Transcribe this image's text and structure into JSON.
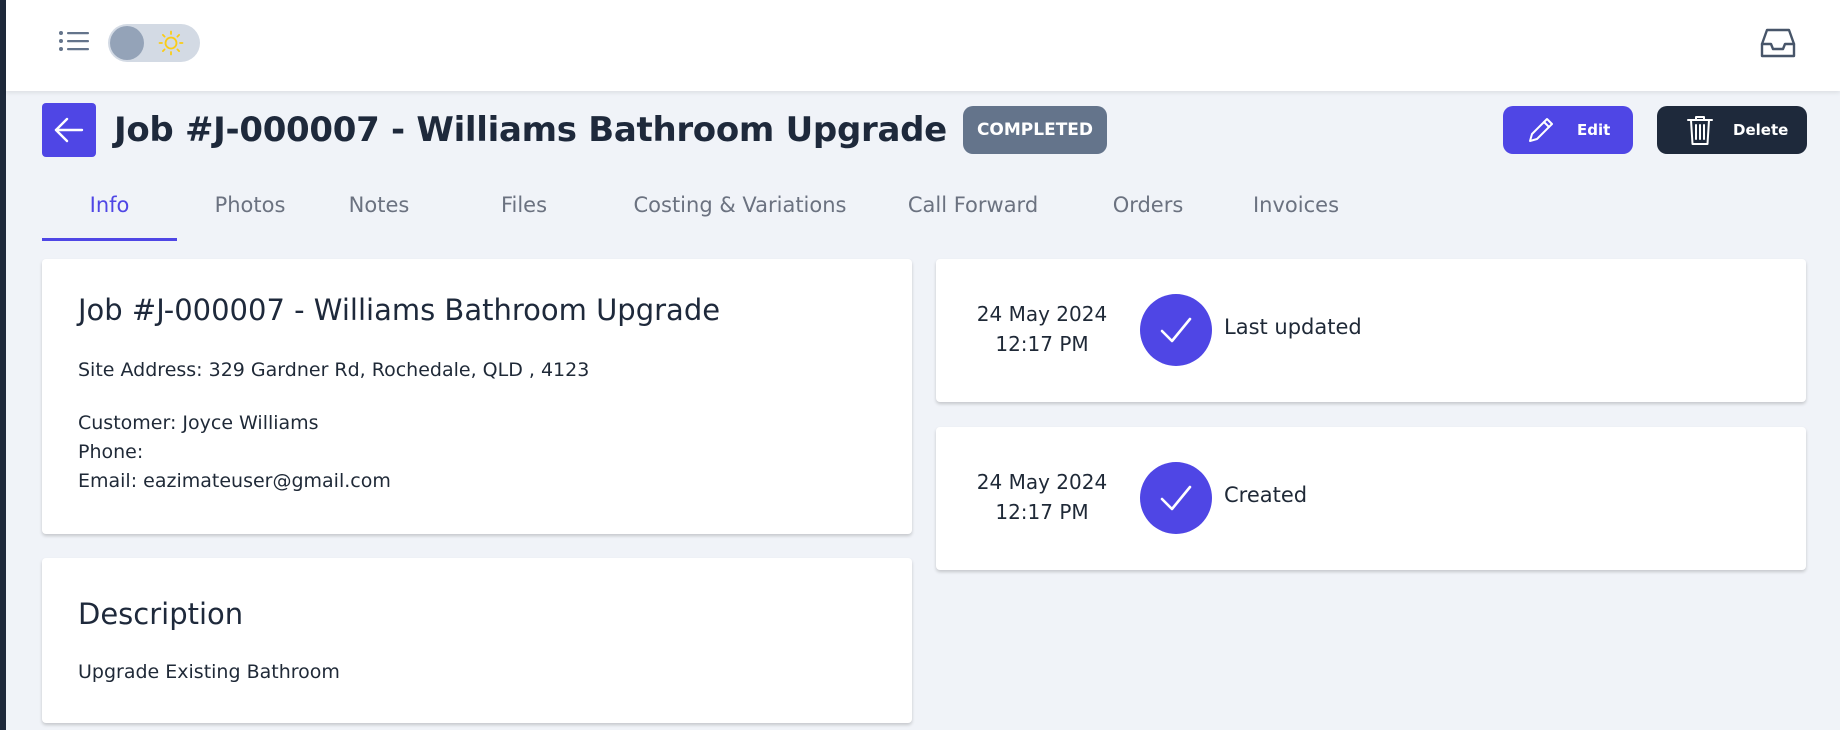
{
  "topbar": {
    "menu_icon": "list-icon",
    "theme_icon": "sun-icon",
    "inbox_icon": "inbox-icon"
  },
  "header": {
    "title": "Job #J-000007 - Williams Bathroom Upgrade",
    "status": "COMPLETED",
    "edit_label": "Edit",
    "delete_label": "Delete"
  },
  "tabs": [
    {
      "label": "Info",
      "active": true
    },
    {
      "label": "Photos"
    },
    {
      "label": "Notes"
    },
    {
      "label": "Files"
    },
    {
      "label": "Costing & Variations"
    },
    {
      "label": "Call Forward"
    },
    {
      "label": "Orders"
    },
    {
      "label": "Invoices"
    }
  ],
  "job": {
    "title": "Job #J-000007 - Williams Bathroom Upgrade",
    "site_address": "Site Address: 329 Gardner Rd, Rochedale, QLD , 4123",
    "customer": "Customer: Joyce Williams",
    "phone": "Phone:",
    "email": "Email: eazimateuser@gmail.com"
  },
  "description": {
    "title": "Description",
    "text": "Upgrade Existing Bathroom"
  },
  "timeline": [
    {
      "date": "24 May 2024",
      "time": "12:17 PM",
      "label": "Last updated"
    },
    {
      "date": "24 May 2024",
      "time": "12:17 PM",
      "label": "Created"
    }
  ],
  "colors": {
    "primary": "#4f46e5",
    "dark": "#1e293b",
    "badge": "#64748b",
    "background": "#f0f3f8"
  }
}
